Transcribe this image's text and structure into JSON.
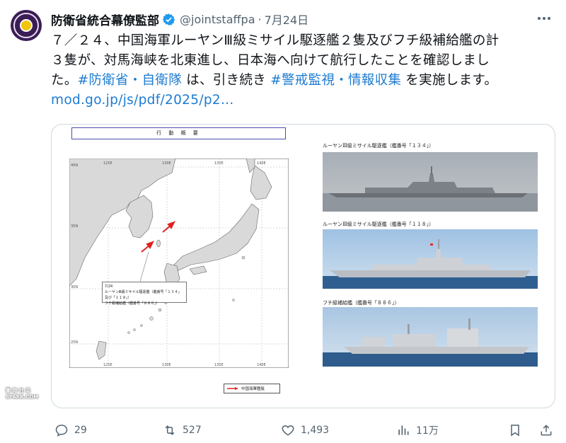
{
  "tweet": {
    "display_name": "防衛省統合幕僚監部",
    "handle": "@jointstaffpa",
    "separator": "·",
    "date": "7月24日",
    "text": {
      "line1": "７／２４、中国海軍ルーヤンⅢ級ミサイル駆逐艦２隻及びフチ級補給艦の計",
      "line2": "３隻が、対馬海峡を北東進し、日本海へ向けて航行したことを確認しまし",
      "line3_pre": "た。",
      "hashtag1": "#防衛省・自衛隊",
      "line3_mid": " は、引き続き ",
      "hashtag2": "#警戒監視・情報収集",
      "line3_post": " を実施します。",
      "link": "mod.go.jp/js/pdf/2025/p2..."
    }
  },
  "media": {
    "outline_title": "行 動 概 要",
    "map_lon_labels": [
      "125E",
      "130E",
      "135E",
      "140E"
    ],
    "map_lat_labels": [
      "40N",
      "35N",
      "30N",
      "25N"
    ],
    "annotation": {
      "date": "7/24",
      "line1": "ルーヤンⅢ級ミサイル駆逐艦（艦番号「１３４」及び「１１８」）",
      "line2": "フチ級補給艦（艦番号「８８６」）"
    },
    "legend_label": "中国海軍艦艇",
    "photos": [
      {
        "caption": "ルーヤンⅢ級ミサイル駆逐艦（艦番号「１３４」）"
      },
      {
        "caption": "ルーヤンⅢ級ミサイル駆逐艦（艦番号「１１８」）"
      },
      {
        "caption": "フチ級補給艦（艦番号「８８６」）"
      }
    ]
  },
  "watermark": {
    "line1": "圖 閱 社 區",
    "line2": "8PARK.COM"
  },
  "actions": {
    "replies": "29",
    "reposts": "527",
    "likes": "1,493",
    "views": "11万"
  },
  "colors": {
    "link": "#1d7bd1",
    "verified": "#1d9bf0",
    "muted": "#536471",
    "sea": "#ffffff",
    "land": "#d9d9d9",
    "route_arrow": "#e02020"
  }
}
